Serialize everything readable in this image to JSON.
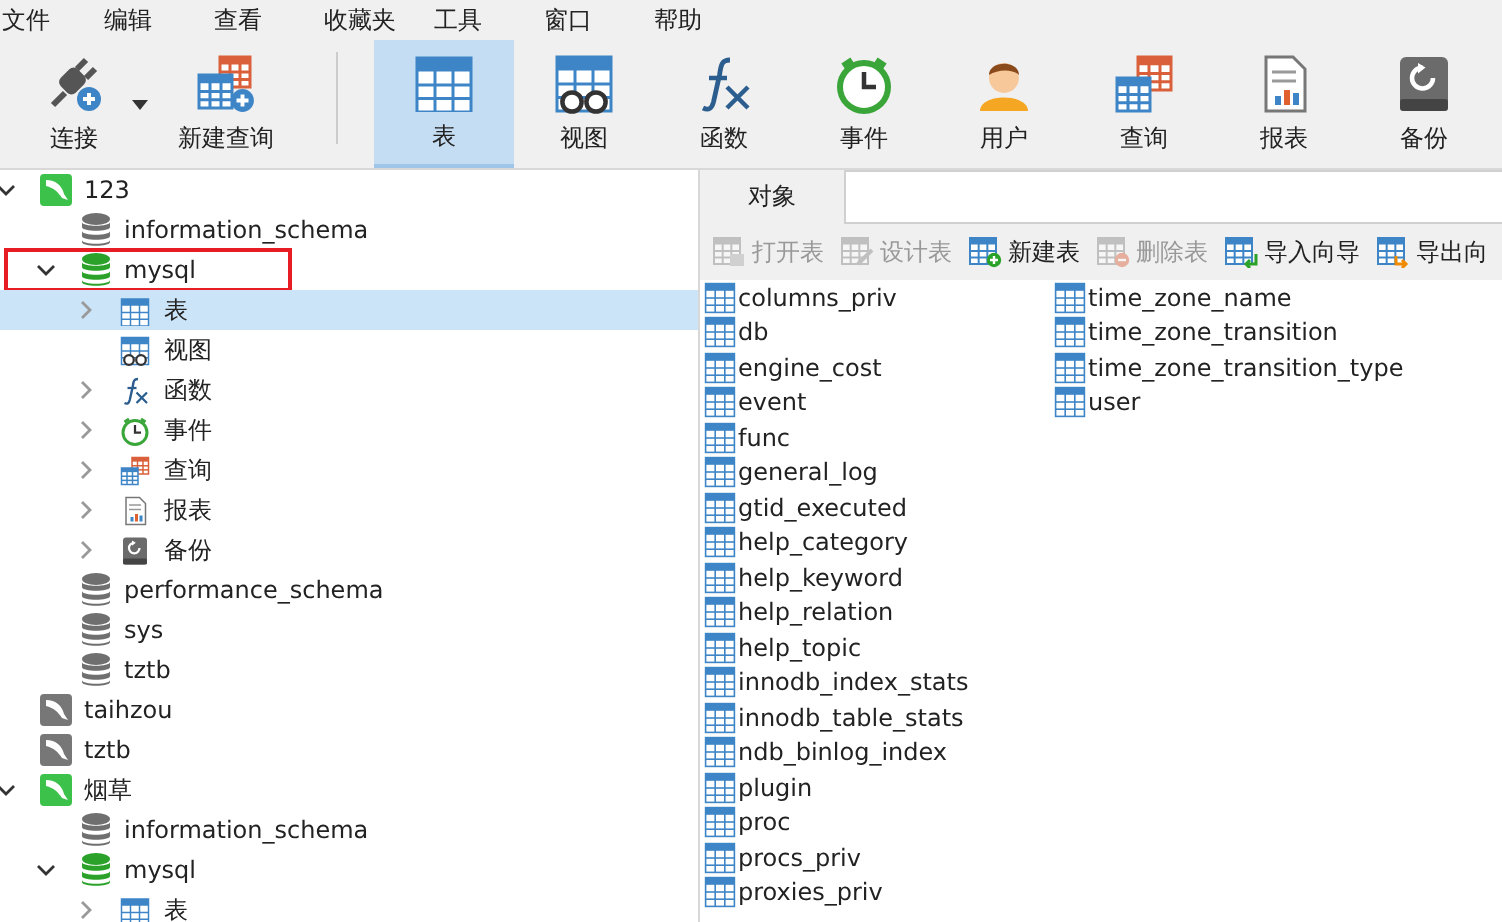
{
  "menu": [
    "文件",
    "编辑",
    "查看",
    "收藏夹",
    "工具",
    "窗口",
    "帮助"
  ],
  "toolbar": [
    {
      "label": "连接",
      "kind": "connect",
      "selected": false,
      "dropdown": true
    },
    {
      "label": "新建查询",
      "kind": "new-query",
      "selected": false
    },
    {
      "label": "表",
      "kind": "tables",
      "selected": true
    },
    {
      "label": "视图",
      "kind": "views",
      "selected": false
    },
    {
      "label": "函数",
      "kind": "functions",
      "selected": false
    },
    {
      "label": "事件",
      "kind": "events",
      "selected": false
    },
    {
      "label": "用户",
      "kind": "users",
      "selected": false
    },
    {
      "label": "查询",
      "kind": "queries",
      "selected": false
    },
    {
      "label": "报表",
      "kind": "reports",
      "selected": false
    },
    {
      "label": "备份",
      "kind": "backups",
      "selected": false
    }
  ],
  "tree": [
    {
      "label": "123",
      "kind": "connection",
      "active": true,
      "expanded": true,
      "selected": false,
      "children": [
        {
          "label": "information_schema",
          "kind": "database",
          "active": false,
          "selected": false
        },
        {
          "label": "mysql",
          "kind": "database",
          "active": true,
          "expanded": true,
          "marked": true,
          "selected": false,
          "children": [
            {
              "label": "表",
              "kind": "tables",
              "expanded": false,
              "selected": true
            },
            {
              "label": "视图",
              "kind": "views",
              "selected": false
            },
            {
              "label": "函数",
              "kind": "functions",
              "expanded": false,
              "selected": false
            },
            {
              "label": "事件",
              "kind": "events",
              "expanded": false,
              "selected": false
            },
            {
              "label": "查询",
              "kind": "queries",
              "expanded": false,
              "selected": false
            },
            {
              "label": "报表",
              "kind": "reports",
              "expanded": false,
              "selected": false
            },
            {
              "label": "备份",
              "kind": "backups",
              "expanded": false,
              "selected": false
            }
          ]
        },
        {
          "label": "performance_schema",
          "kind": "database",
          "active": false,
          "selected": false
        },
        {
          "label": "sys",
          "kind": "database",
          "active": false,
          "selected": false
        },
        {
          "label": "tztb",
          "kind": "database",
          "active": false,
          "selected": false
        }
      ]
    },
    {
      "label": "taihzou",
      "kind": "connection",
      "active": false,
      "selected": false
    },
    {
      "label": "tztb",
      "kind": "connection",
      "active": false,
      "selected": false
    },
    {
      "label": "烟草",
      "kind": "connection",
      "active": true,
      "expanded": true,
      "selected": false,
      "children": [
        {
          "label": "information_schema",
          "kind": "database",
          "active": false,
          "selected": false
        },
        {
          "label": "mysql",
          "kind": "database",
          "active": true,
          "expanded": true,
          "selected": false,
          "children": [
            {
              "label": "表",
              "kind": "tables",
              "expanded": false,
              "selected": false
            }
          ]
        }
      ]
    }
  ],
  "tabs": [
    {
      "label": "对象",
      "selected": true
    }
  ],
  "object_toolbar": [
    {
      "label": "打开表",
      "kind": "open",
      "disabled": true
    },
    {
      "label": "设计表",
      "kind": "design",
      "disabled": true
    },
    {
      "label": "新建表",
      "kind": "new",
      "disabled": false
    },
    {
      "label": "删除表",
      "kind": "delete",
      "disabled": true
    },
    {
      "label": "导入向导",
      "kind": "import",
      "disabled": false
    },
    {
      "label": "导出向",
      "kind": "export",
      "disabled": false
    }
  ],
  "tables": [
    "columns_priv",
    "db",
    "engine_cost",
    "event",
    "func",
    "general_log",
    "gtid_executed",
    "help_category",
    "help_keyword",
    "help_relation",
    "help_topic",
    "innodb_index_stats",
    "innodb_table_stats",
    "ndb_binlog_index",
    "plugin",
    "proc",
    "procs_priv",
    "proxies_priv",
    "time_zone_name",
    "time_zone_transition",
    "time_zone_transition_type",
    "user"
  ]
}
